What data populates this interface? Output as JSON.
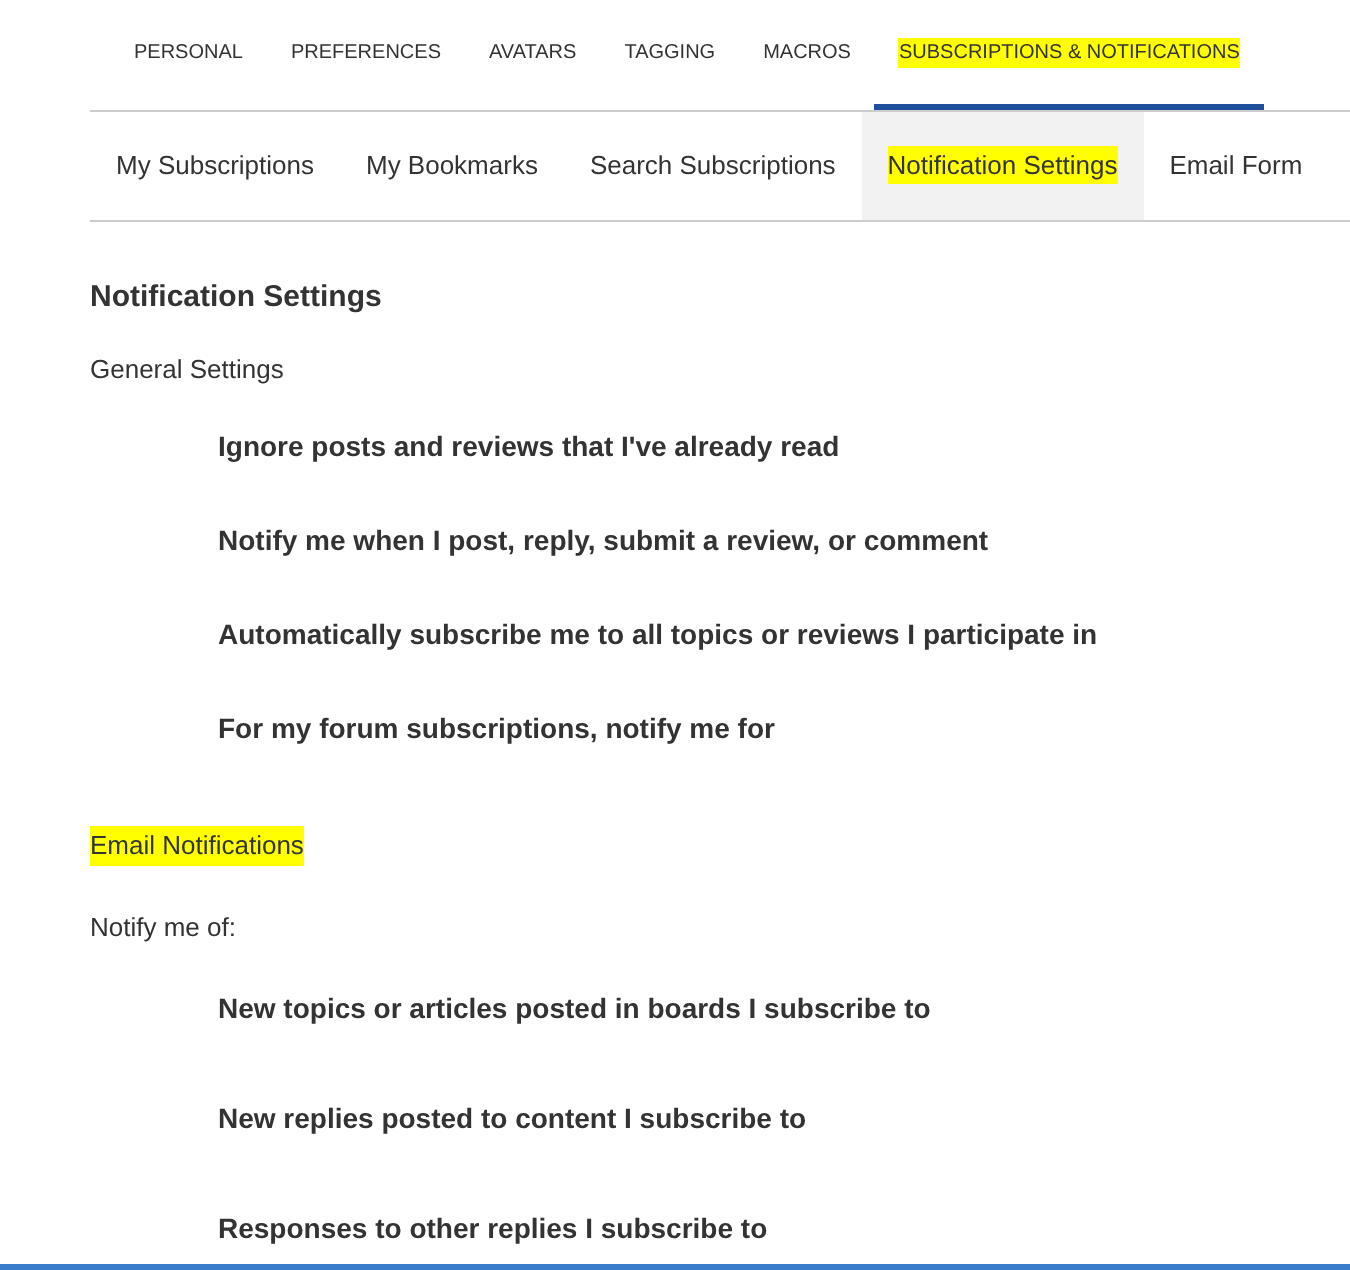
{
  "tabs": [
    {
      "label": "PERSONAL",
      "selected": false,
      "highlighted": false
    },
    {
      "label": "PREFERENCES",
      "selected": false,
      "highlighted": false
    },
    {
      "label": "AVATARS",
      "selected": false,
      "highlighted": false
    },
    {
      "label": "TAGGING",
      "selected": false,
      "highlighted": false
    },
    {
      "label": "MACROS",
      "selected": false,
      "highlighted": false
    },
    {
      "label": "SUBSCRIPTIONS & NOTIFICATIONS",
      "selected": true,
      "highlighted": true
    }
  ],
  "subtabs": [
    {
      "label": "My Subscriptions",
      "selected": false,
      "highlighted": false
    },
    {
      "label": "My Bookmarks",
      "selected": false,
      "highlighted": false
    },
    {
      "label": "Search Subscriptions",
      "selected": false,
      "highlighted": false
    },
    {
      "label": "Notification Settings",
      "selected": true,
      "highlighted": true
    },
    {
      "label": "Email Form",
      "selected": false,
      "highlighted": false
    }
  ],
  "heading": "Notification Settings",
  "general": {
    "title": "General Settings",
    "highlighted": false,
    "options": [
      "Ignore posts and reviews that I've already read",
      "Notify me when I post, reply, submit a review, or comment",
      "Automatically subscribe me to all topics or reviews I participate in",
      "For my forum subscriptions, notify me for"
    ]
  },
  "email": {
    "title": "Email Notifications",
    "highlighted": true,
    "intro": "Notify me of:",
    "options": [
      "New topics or articles posted in boards I subscribe to",
      "New replies posted to content I subscribe to",
      "Responses to other replies I subscribe to"
    ]
  }
}
